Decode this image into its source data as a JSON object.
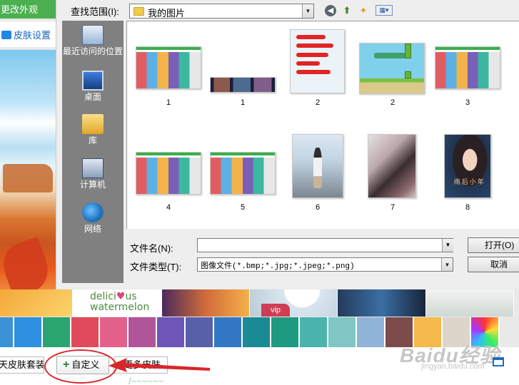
{
  "skin_panel": {
    "header_title": "更改外观",
    "settings_label": "皮肤设置",
    "thumb_text": {
      "before": "delici",
      "heart": "♥",
      "after": "us",
      "line2": "watermelon"
    },
    "vip_badge": "vip",
    "swatch_colors": [
      "#3b92d6",
      "#2f8fe0",
      "#2aa56f",
      "#e04a5a",
      "#e3618b",
      "#b0559a",
      "#6e55b8",
      "#5661a8",
      "#3278c4",
      "#1a8a95",
      "#1e9a80",
      "#4bb3ae",
      "#7fc6c5",
      "#90b4d8",
      "#7d4a4a",
      "#f6b94c",
      "#ddd5ca",
      "#e6e6e6"
    ],
    "buttons": {
      "skin_suite": "天皮肤套装",
      "custom": "自定义",
      "more_skins": "更多皮肤"
    },
    "bottom_text": "/~~~~~~",
    "watermark_logo": "Baidu经验",
    "watermark_url": "jingyan.baidu.com"
  },
  "dialog": {
    "look_in_label": "查找范围(I):",
    "look_in_value": "我的图片",
    "toolbar": {
      "back": "◀",
      "up": "⬆",
      "new_folder": "✦",
      "views": "▦▾"
    },
    "places": [
      {
        "label": "最近访问的位置",
        "icon": "recent-places-icon"
      },
      {
        "label": "桌面",
        "icon": "desktop-icon"
      },
      {
        "label": "库",
        "icon": "library-icon"
      },
      {
        "label": "计算机",
        "icon": "computer-icon"
      },
      {
        "label": "网络",
        "icon": "network-icon"
      }
    ],
    "files": [
      "1",
      "1",
      "2",
      "2",
      "3",
      "4",
      "5",
      "6",
      "7",
      "8"
    ],
    "photo3_caption": "雨后小年",
    "file_name_label": "文件名(N):",
    "file_name_value": "",
    "file_type_label": "文件类型(T):",
    "file_type_value": "图像文件(*.bmp;*.jpg;*.jpeg;*.png)",
    "open_button": "打开(O)",
    "cancel_button": "取消"
  }
}
